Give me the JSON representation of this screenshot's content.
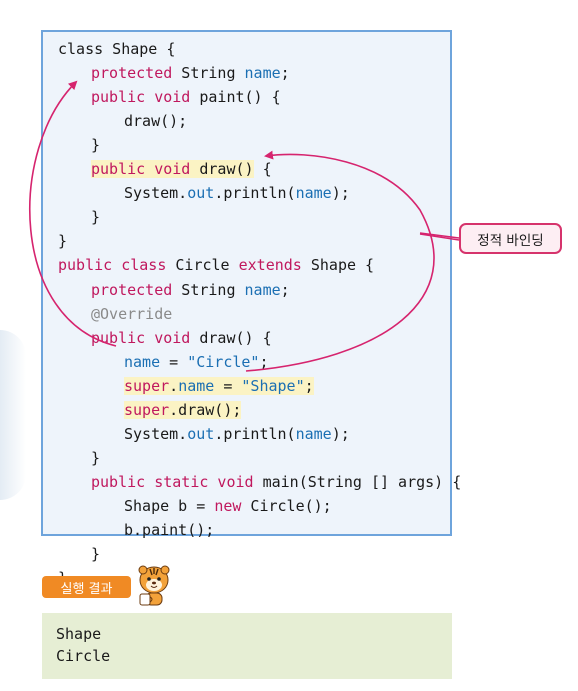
{
  "code": {
    "lines": [
      {
        "indent": 0,
        "parts": [
          {
            "t": "class Shape {",
            "c": "plain"
          }
        ]
      },
      {
        "indent": 1,
        "parts": [
          {
            "t": "protected",
            "c": "kw"
          },
          {
            "t": " String ",
            "c": "plain"
          },
          {
            "t": "name",
            "c": "id"
          },
          {
            "t": ";",
            "c": "plain"
          }
        ]
      },
      {
        "indent": 1,
        "parts": [
          {
            "t": "public void",
            "c": "kw"
          },
          {
            "t": " paint() {",
            "c": "plain"
          }
        ]
      },
      {
        "indent": 2,
        "parts": [
          {
            "t": "draw();",
            "c": "plain"
          }
        ]
      },
      {
        "indent": 1,
        "parts": [
          {
            "t": "}",
            "c": "plain"
          }
        ]
      },
      {
        "indent": 1,
        "highlight": true,
        "parts": [
          {
            "t": "public void",
            "c": "kw"
          },
          {
            "t": " draw()",
            "c": "plain"
          }
        ],
        "tail": " {"
      },
      {
        "indent": 2,
        "parts": [
          {
            "t": "System.",
            "c": "plain"
          },
          {
            "t": "out",
            "c": "id"
          },
          {
            "t": ".println(",
            "c": "plain"
          },
          {
            "t": "name",
            "c": "id"
          },
          {
            "t": ");",
            "c": "plain"
          }
        ]
      },
      {
        "indent": 1,
        "parts": [
          {
            "t": "}",
            "c": "plain"
          }
        ]
      },
      {
        "indent": 0,
        "parts": [
          {
            "t": "}",
            "c": "plain"
          }
        ]
      },
      {
        "indent": 0,
        "parts": [
          {
            "t": "public class",
            "c": "kw"
          },
          {
            "t": " Circle ",
            "c": "plain"
          },
          {
            "t": "extends",
            "c": "kw"
          },
          {
            "t": " Shape {",
            "c": "plain"
          }
        ]
      },
      {
        "indent": 1,
        "parts": [
          {
            "t": "protected",
            "c": "kw"
          },
          {
            "t": " String ",
            "c": "plain"
          },
          {
            "t": "name",
            "c": "id"
          },
          {
            "t": ";",
            "c": "plain"
          }
        ]
      },
      {
        "indent": 1,
        "parts": [
          {
            "t": "@Override",
            "c": "ann"
          }
        ]
      },
      {
        "indent": 1,
        "parts": [
          {
            "t": "public void",
            "c": "kw"
          },
          {
            "t": " draw() {",
            "c": "plain"
          }
        ]
      },
      {
        "indent": 2,
        "parts": [
          {
            "t": "name",
            "c": "id"
          },
          {
            "t": " = ",
            "c": "plain"
          },
          {
            "t": "\"Circle\"",
            "c": "str"
          },
          {
            "t": ";",
            "c": "plain"
          }
        ]
      },
      {
        "indent": 2,
        "highlight": true,
        "parts": [
          {
            "t": "super",
            "c": "kw"
          },
          {
            "t": ".",
            "c": "plain"
          },
          {
            "t": "name",
            "c": "id"
          },
          {
            "t": " = ",
            "c": "plain"
          },
          {
            "t": "\"Shape\"",
            "c": "str"
          },
          {
            "t": ";",
            "c": "plain"
          }
        ]
      },
      {
        "indent": 2,
        "highlight": true,
        "parts": [
          {
            "t": "super",
            "c": "kw"
          },
          {
            "t": ".draw();",
            "c": "plain"
          }
        ]
      },
      {
        "indent": 2,
        "parts": [
          {
            "t": "System.",
            "c": "plain"
          },
          {
            "t": "out",
            "c": "id"
          },
          {
            "t": ".println(",
            "c": "plain"
          },
          {
            "t": "name",
            "c": "id"
          },
          {
            "t": ");",
            "c": "plain"
          }
        ]
      },
      {
        "indent": 1,
        "parts": [
          {
            "t": "}",
            "c": "plain"
          }
        ]
      },
      {
        "indent": 1,
        "parts": [
          {
            "t": "public static void",
            "c": "kw"
          },
          {
            "t": " main(String [] args) {",
            "c": "plain"
          }
        ]
      },
      {
        "indent": 2,
        "parts": [
          {
            "t": "Shape b = ",
            "c": "plain"
          },
          {
            "t": "new",
            "c": "kw"
          },
          {
            "t": " Circle();",
            "c": "plain"
          }
        ]
      },
      {
        "indent": 2,
        "parts": [
          {
            "t": "b.paint();",
            "c": "plain"
          }
        ]
      },
      {
        "indent": 1,
        "parts": [
          {
            "t": "}",
            "c": "plain"
          }
        ]
      },
      {
        "indent": 0,
        "parts": [
          {
            "t": "}",
            "c": "plain"
          }
        ]
      }
    ]
  },
  "callout": {
    "label": "정적 바인딩"
  },
  "result": {
    "badge_label": "실행 결과",
    "output_lines": [
      "Shape",
      "Circle"
    ]
  },
  "colors": {
    "keyword": "#c0185e",
    "identifier": "#1b6fb3",
    "annotation": "#8a8a8a",
    "highlight": "#fbf3c4",
    "arrow": "#d6246e",
    "badge": "#f08a24",
    "output_bg": "#e6eed4",
    "code_border": "#6ea4dc"
  },
  "icons": {
    "mascot": "tiger-mascot-icon"
  }
}
